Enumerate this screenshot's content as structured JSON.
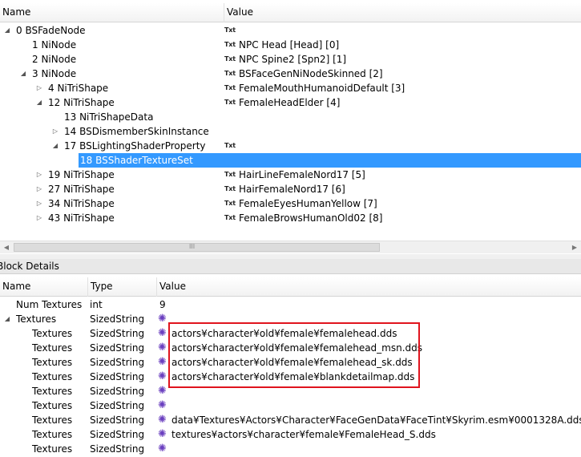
{
  "tree": {
    "columns": {
      "name": "Name",
      "value": "Value"
    },
    "rows": [
      {
        "label": "0 BSFadeNode",
        "toggle": "open",
        "indent": 0,
        "txt": true,
        "value": ""
      },
      {
        "label": "1 NiNode",
        "toggle": "none",
        "indent": 1,
        "txt": true,
        "value": "NPC Head [Head] [0]"
      },
      {
        "label": "2 NiNode",
        "toggle": "none",
        "indent": 1,
        "txt": true,
        "value": "NPC Spine2 [Spn2] [1]"
      },
      {
        "label": "3 NiNode",
        "toggle": "open",
        "indent": 1,
        "txt": true,
        "value": "BSFaceGenNiNodeSkinned [2]"
      },
      {
        "label": "4 NiTriShape",
        "toggle": "closed",
        "indent": 2,
        "txt": true,
        "value": "FemaleMouthHumanoidDefault [3]"
      },
      {
        "label": "12 NiTriShape",
        "toggle": "open",
        "indent": 2,
        "txt": true,
        "value": "FemaleHeadElder [4]"
      },
      {
        "label": "13 NiTriShapeData",
        "toggle": "none",
        "indent": 3,
        "txt": false,
        "value": ""
      },
      {
        "label": "14 BSDismemberSkinInstance",
        "toggle": "closed",
        "indent": 3,
        "txt": false,
        "value": ""
      },
      {
        "label": "17 BSLightingShaderProperty",
        "toggle": "open",
        "indent": 3,
        "txt": true,
        "value": ""
      },
      {
        "label": "18 BSShaderTextureSet",
        "toggle": "none",
        "indent": 4,
        "txt": false,
        "value": "",
        "selected": true
      },
      {
        "label": "19 NiTriShape",
        "toggle": "closed",
        "indent": 2,
        "txt": true,
        "value": "HairLineFemaleNord17 [5]"
      },
      {
        "label": "27 NiTriShape",
        "toggle": "closed",
        "indent": 2,
        "txt": true,
        "value": "HairFemaleNord17 [6]"
      },
      {
        "label": "34 NiTriShape",
        "toggle": "closed",
        "indent": 2,
        "txt": true,
        "value": "FemaleEyesHumanYellow [7]"
      },
      {
        "label": "43 NiTriShape",
        "toggle": "closed",
        "indent": 2,
        "txt": true,
        "value": "FemaleBrowsHumanOld02 [8]"
      }
    ],
    "txt_icon_label": "Txt"
  },
  "block_details": {
    "title": "Block Details",
    "columns": {
      "name": "Name",
      "type": "Type",
      "value": "Value"
    },
    "rows": [
      {
        "name": "Num Textures",
        "type": "int",
        "value": "9",
        "icon": false,
        "toggle": "none",
        "indent": 1
      },
      {
        "name": "Textures",
        "type": "SizedString",
        "value": "",
        "icon": true,
        "toggle": "open",
        "indent": 0
      },
      {
        "name": "Textures",
        "type": "SizedString",
        "value": "actors¥character¥old¥female¥femalehead.dds",
        "icon": true,
        "toggle": "none",
        "indent": 2
      },
      {
        "name": "Textures",
        "type": "SizedString",
        "value": "actors¥character¥old¥female¥femalehead_msn.dds",
        "icon": true,
        "toggle": "none",
        "indent": 2
      },
      {
        "name": "Textures",
        "type": "SizedString",
        "value": "actors¥character¥old¥female¥femalehead_sk.dds",
        "icon": true,
        "toggle": "none",
        "indent": 2
      },
      {
        "name": "Textures",
        "type": "SizedString",
        "value": "actors¥character¥old¥female¥blankdetailmap.dds",
        "icon": true,
        "toggle": "none",
        "indent": 2
      },
      {
        "name": "Textures",
        "type": "SizedString",
        "value": "",
        "icon": true,
        "toggle": "none",
        "indent": 2
      },
      {
        "name": "Textures",
        "type": "SizedString",
        "value": "",
        "icon": true,
        "toggle": "none",
        "indent": 2
      },
      {
        "name": "Textures",
        "type": "SizedString",
        "value": "data¥Textures¥Actors¥Character¥FaceGenData¥FaceTint¥Skyrim.esm¥0001328A.dds",
        "icon": true,
        "toggle": "none",
        "indent": 2
      },
      {
        "name": "Textures",
        "type": "SizedString",
        "value": "textures¥actors¥character¥female¥FemaleHead_S.dds",
        "icon": true,
        "toggle": "none",
        "indent": 2
      },
      {
        "name": "Textures",
        "type": "SizedString",
        "value": "",
        "icon": true,
        "toggle": "none",
        "indent": 2
      }
    ]
  },
  "scrollbar": {
    "grip": "III"
  },
  "colors": {
    "selection": "#3399ff",
    "highlight_box": "#e0141e",
    "string_icon": "#6a3fbf"
  }
}
